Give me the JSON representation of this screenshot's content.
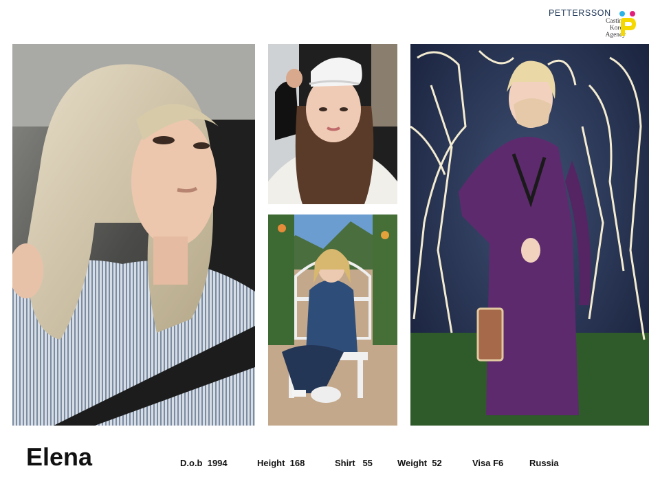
{
  "brand": {
    "name": "PETTERSSON",
    "sub_lines": [
      "Casting",
      "Korea",
      "Agency"
    ],
    "colors": {
      "cyan": "#2bb3e6",
      "magenta": "#e0207a",
      "yellow": "#f5d800",
      "navy": "#1d3557"
    }
  },
  "photos": [
    {
      "icon": "portrait-car-selfie"
    },
    {
      "icon": "portrait-cap-selfie"
    },
    {
      "icon": "portrait-park-bench"
    },
    {
      "icon": "portrait-purple-dress-lights"
    }
  ],
  "profile": {
    "name": "Elena",
    "dob": "D.o.b  1994",
    "height": "Height  168",
    "shirt": "Shirt   55",
    "weight": "Weight  52",
    "visa": "Visa F6",
    "country": "Russia"
  }
}
